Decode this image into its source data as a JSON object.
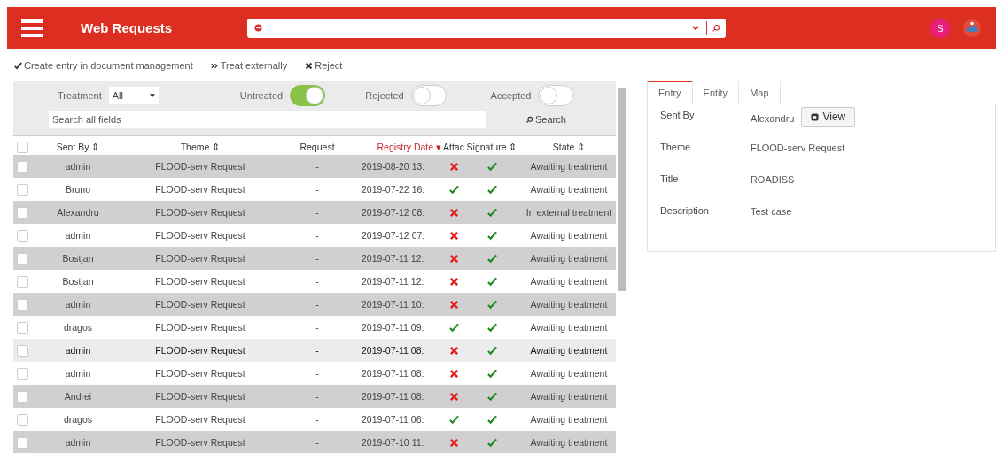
{
  "app_bar": {
    "title": "Web Requests",
    "user_initial": "S"
  },
  "actions": [
    {
      "kind": "check",
      "label": "Create entry in document management"
    },
    {
      "kind": "forward",
      "label": "Treat externally"
    },
    {
      "kind": "cross",
      "label": "Reject"
    }
  ],
  "filters": {
    "treatment_label": "Treatment",
    "treatment_value": "All",
    "toggles": [
      {
        "label": "Untreated",
        "on": true
      },
      {
        "label": "Rejected",
        "on": false
      },
      {
        "label": "Accepted",
        "on": false
      }
    ],
    "search_placeholder": "Search all fields",
    "search_button": "Search"
  },
  "table": {
    "select_all_checked": false,
    "columns": [
      {
        "label": "Sent By ⇕",
        "sorted": false
      },
      {
        "label": "Theme ⇕",
        "sorted": false
      },
      {
        "label": "Request",
        "sorted": false
      },
      {
        "label": "Registry Date ▾",
        "sorted": true
      },
      {
        "label": "Attac",
        "sorted": false
      },
      {
        "label": "Signature ⇕",
        "sorted": false
      },
      {
        "label": "State ⇕",
        "sorted": false
      }
    ],
    "rows": [
      {
        "sent_by": "admin",
        "theme": "FLOOD-serv Request",
        "request": "-",
        "date": "2019-08-20 13:",
        "attachment": false,
        "signature": true,
        "state": "Awaiting treatment",
        "checked": false,
        "hovered": false
      },
      {
        "sent_by": "Bruno",
        "theme": "FLOOD-serv Request",
        "request": "-",
        "date": "2019-07-22 16:",
        "attachment": true,
        "signature": true,
        "state": "Awaiting treatment",
        "checked": false,
        "hovered": false
      },
      {
        "sent_by": "Alexandru",
        "theme": "FLOOD-serv Request",
        "request": "-",
        "date": "2019-07-12 08:",
        "attachment": false,
        "signature": true,
        "state": "In external treatment",
        "checked": false,
        "hovered": false
      },
      {
        "sent_by": "admin",
        "theme": "FLOOD-serv Request",
        "request": "-",
        "date": "2019-07-12 07:",
        "attachment": false,
        "signature": true,
        "state": "Awaiting treatment",
        "checked": false,
        "hovered": false
      },
      {
        "sent_by": "Bostjan",
        "theme": "FLOOD-serv Request",
        "request": "-",
        "date": "2019-07-11 12:",
        "attachment": false,
        "signature": true,
        "state": "Awaiting treatment",
        "checked": false,
        "hovered": false
      },
      {
        "sent_by": "Bostjan",
        "theme": "FLOOD-serv Request",
        "request": "-",
        "date": "2019-07-11 12:",
        "attachment": false,
        "signature": true,
        "state": "Awaiting treatment",
        "checked": false,
        "hovered": false
      },
      {
        "sent_by": "admin",
        "theme": "FLOOD-serv Request",
        "request": "-",
        "date": "2019-07-11 10:",
        "attachment": false,
        "signature": true,
        "state": "Awaiting treatment",
        "checked": false,
        "hovered": false
      },
      {
        "sent_by": "dragos",
        "theme": "FLOOD-serv Request",
        "request": "-",
        "date": "2019-07-11 09:",
        "attachment": true,
        "signature": true,
        "state": "Awaiting treatment",
        "checked": false,
        "hovered": false
      },
      {
        "sent_by": "admin",
        "theme": "FLOOD-serv Request",
        "request": "-",
        "date": "2019-07-11 08:",
        "attachment": false,
        "signature": true,
        "state": "Awaiting treatment",
        "checked": false,
        "hovered": true
      },
      {
        "sent_by": "admin",
        "theme": "FLOOD-serv Request",
        "request": "-",
        "date": "2019-07-11 08:",
        "attachment": false,
        "signature": true,
        "state": "Awaiting treatment",
        "checked": false,
        "hovered": false
      },
      {
        "sent_by": "Andrei",
        "theme": "FLOOD-serv Request",
        "request": "-",
        "date": "2019-07-11 08:",
        "attachment": false,
        "signature": true,
        "state": "Awaiting treatment",
        "checked": false,
        "hovered": false
      },
      {
        "sent_by": "dragos",
        "theme": "FLOOD-serv Request",
        "request": "-",
        "date": "2019-07-11 06:",
        "attachment": true,
        "signature": true,
        "state": "Awaiting treatment",
        "checked": false,
        "hovered": false
      },
      {
        "sent_by": "admin",
        "theme": "FLOOD-serv Request",
        "request": "-",
        "date": "2019-07-10 11:",
        "attachment": false,
        "signature": true,
        "state": "Awaiting treatment",
        "checked": false,
        "hovered": false
      }
    ]
  },
  "detail": {
    "tabs": [
      {
        "label": "Entry",
        "selected": true
      },
      {
        "label": "Entity",
        "selected": false
      },
      {
        "label": "Map",
        "selected": false
      }
    ],
    "fields": [
      {
        "label": "Sent By",
        "value": "Alexandru",
        "button": "View"
      },
      {
        "label": "Theme",
        "value": "FLOOD-serv Request"
      },
      {
        "label": "Title",
        "value": "ROADISS"
      },
      {
        "label": "Description",
        "value": "Test case"
      }
    ]
  }
}
